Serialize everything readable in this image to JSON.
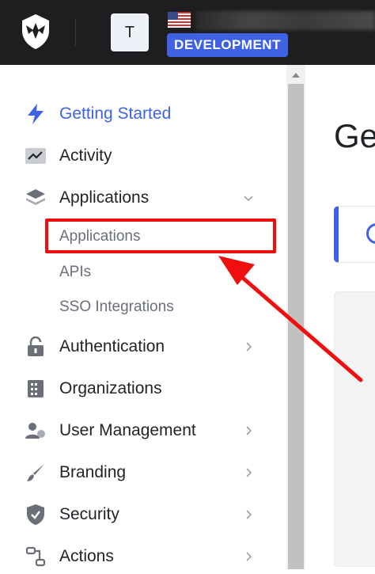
{
  "header": {
    "tenant_initial": "T",
    "environment_badge": "DEVELOPMENT"
  },
  "sidebar": {
    "items": [
      {
        "label": "Getting Started",
        "icon": "lightning-icon",
        "active": true
      },
      {
        "label": "Activity",
        "icon": "activity-chart-icon"
      },
      {
        "label": "Applications",
        "icon": "layers-icon",
        "expanded": true,
        "children": [
          "Applications",
          "APIs",
          "SSO Integrations"
        ]
      },
      {
        "label": "Authentication",
        "icon": "lock-icon"
      },
      {
        "label": "Organizations",
        "icon": "building-icon"
      },
      {
        "label": "User Management",
        "icon": "users-icon"
      },
      {
        "label": "Branding",
        "icon": "paintbrush-icon"
      },
      {
        "label": "Security",
        "icon": "shield-check-icon"
      },
      {
        "label": "Actions",
        "icon": "actions-flow-icon"
      }
    ]
  },
  "main": {
    "title_partial": "Ge"
  },
  "colors": {
    "accent": "#3e62e3",
    "annotation": "#f00f0f",
    "topbar": "#1e1e20"
  }
}
